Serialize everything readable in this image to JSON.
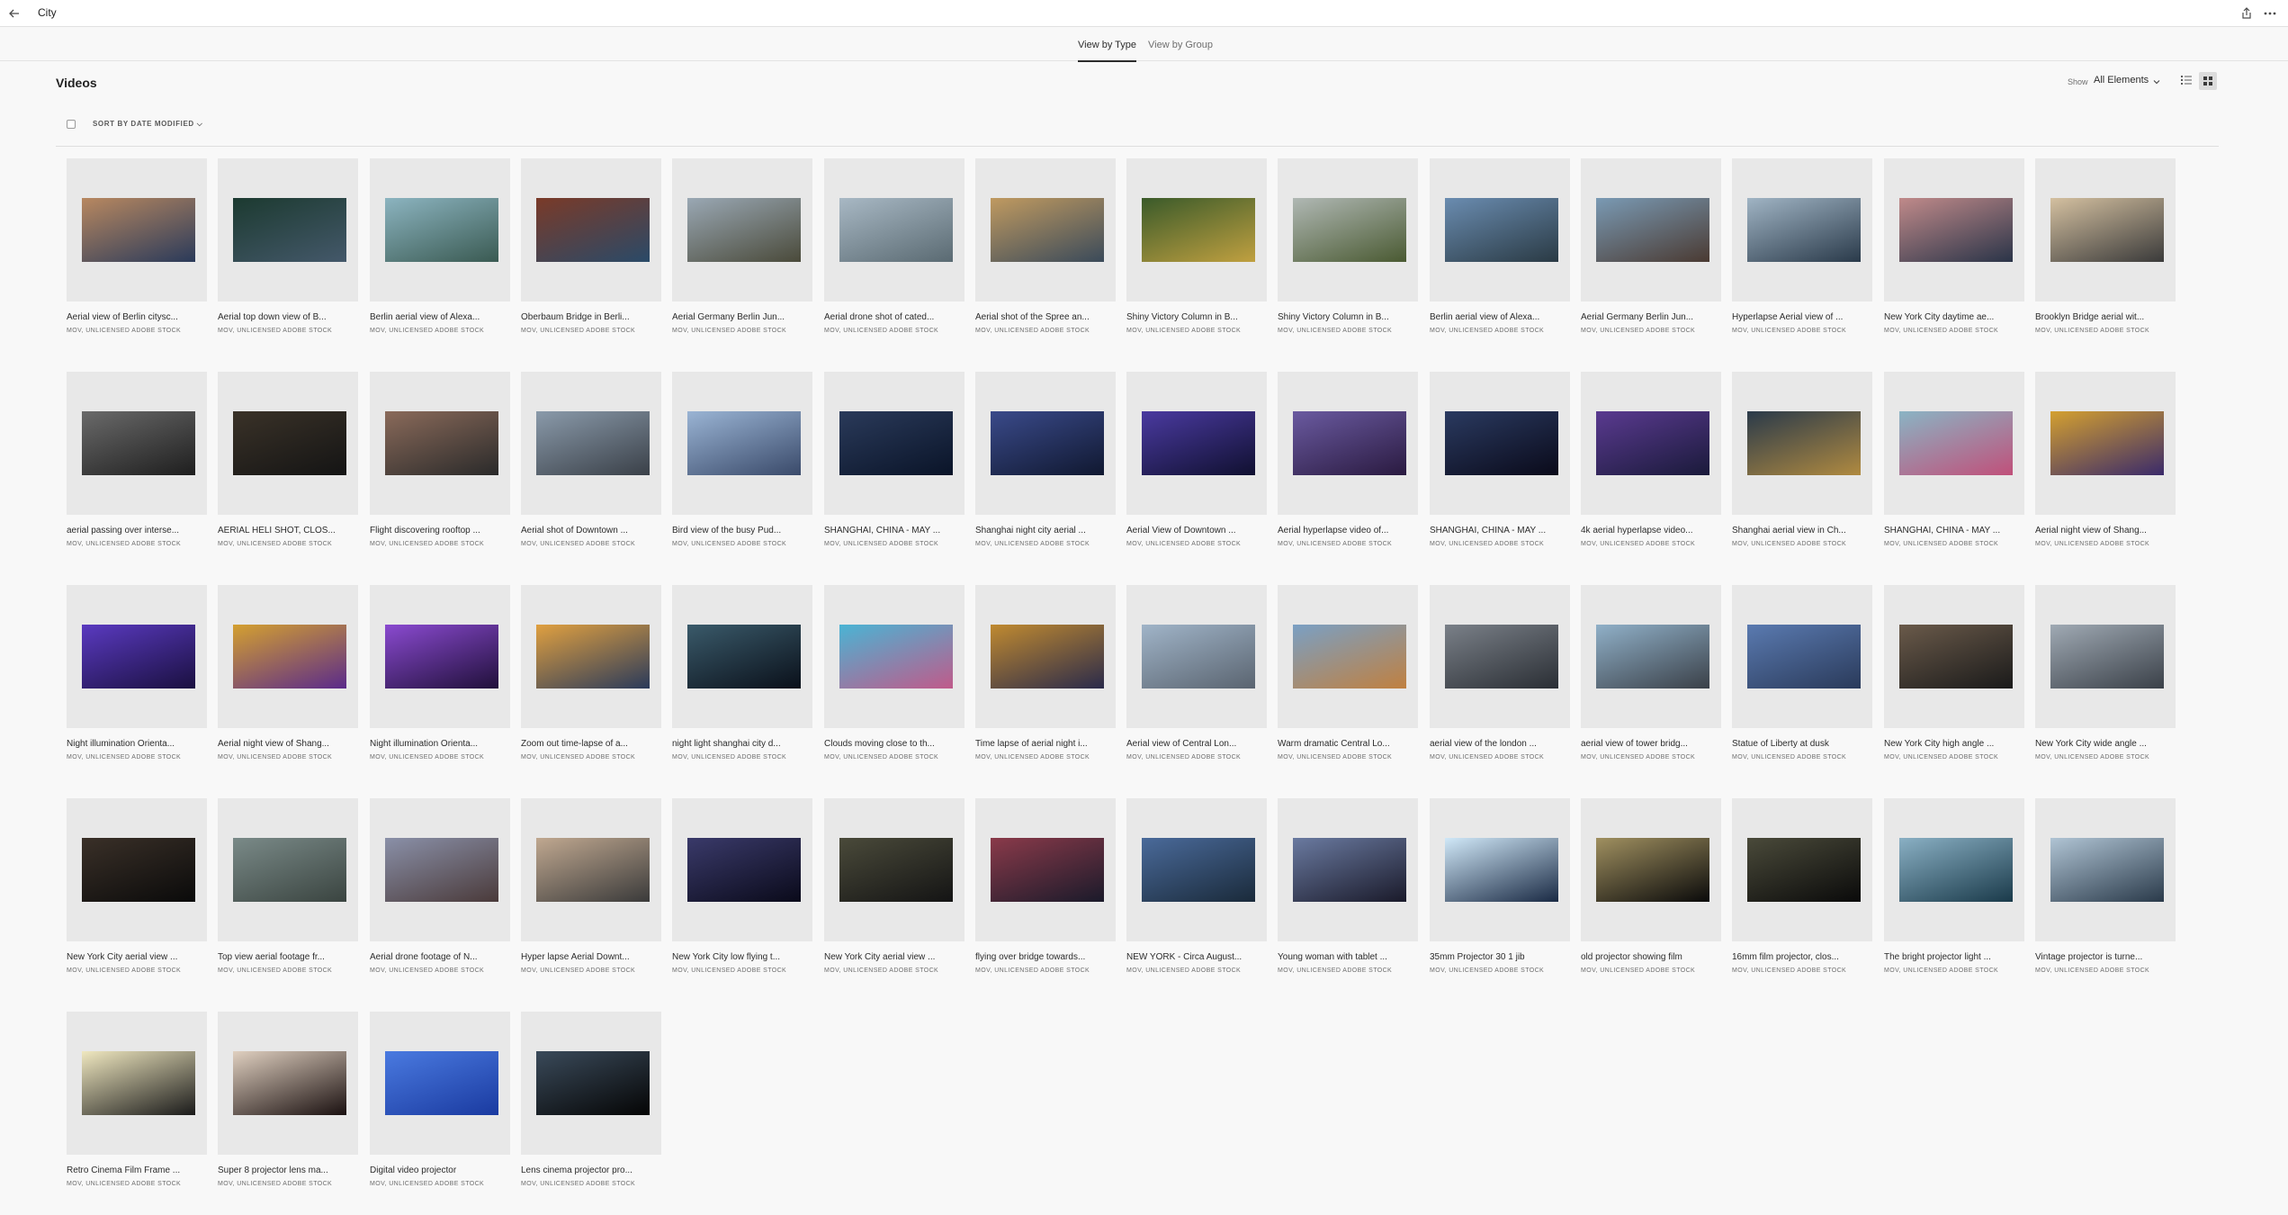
{
  "app": {
    "title": "City"
  },
  "tabs": [
    {
      "label": "View by Type"
    },
    {
      "label": "View by Group"
    }
  ],
  "section": {
    "title": "Videos"
  },
  "filter": {
    "show_label": "Show",
    "show_value": "All Elements"
  },
  "sort": {
    "label": "SORT BY DATE MODIFIED"
  },
  "colors": {
    "thumb_bg": "#e8e8e8",
    "active_tab_underline": "#2c2c2c"
  },
  "icons": {
    "back": "arrow-left-icon",
    "share": "share-icon",
    "more": "more-icon",
    "list": "list-view-icon",
    "grid": "grid-view-icon"
  },
  "items": [
    {
      "name": "Aerial view of Berlin citysc...",
      "meta": "MOV, UNLICENSED ADOBE STOCK",
      "c1": "#b88860",
      "c2": "#2a3a5a"
    },
    {
      "name": "Aerial top down view of B...",
      "meta": "MOV, UNLICENSED ADOBE STOCK",
      "c1": "#1c3a30",
      "c2": "#44586a"
    },
    {
      "name": "Berlin aerial view of Alexa...",
      "meta": "MOV, UNLICENSED ADOBE STOCK",
      "c1": "#8cb4c0",
      "c2": "#3a5a52"
    },
    {
      "name": "Oberbaum Bridge in Berli...",
      "meta": "MOV, UNLICENSED ADOBE STOCK",
      "c1": "#7a3a28",
      "c2": "#2a4a68"
    },
    {
      "name": "Aerial Germany Berlin Jun...",
      "meta": "MOV, UNLICENSED ADOBE STOCK",
      "c1": "#9aa8b4",
      "c2": "#4a4a3a"
    },
    {
      "name": "Aerial drone shot of cated...",
      "meta": "MOV, UNLICENSED ADOBE STOCK",
      "c1": "#a8b8c4",
      "c2": "#5a6a72"
    },
    {
      "name": "Aerial shot of the Spree an...",
      "meta": "MOV, UNLICENSED ADOBE STOCK",
      "c1": "#c09a60",
      "c2": "#3a4a5a"
    },
    {
      "name": "Shiny Victory Column in B...",
      "meta": "MOV, UNLICENSED ADOBE STOCK",
      "c1": "#3a5a2a",
      "c2": "#c0a040"
    },
    {
      "name": "Shiny Victory Column in B...",
      "meta": "MOV, UNLICENSED ADOBE STOCK",
      "c1": "#b0b8b4",
      "c2": "#4a5a32"
    },
    {
      "name": "Berlin aerial view of Alexa...",
      "meta": "MOV, UNLICENSED ADOBE STOCK",
      "c1": "#6a8cb0",
      "c2": "#2a3a44"
    },
    {
      "name": "Aerial Germany Berlin Jun...",
      "meta": "MOV, UNLICENSED ADOBE STOCK",
      "c1": "#7a9ab4",
      "c2": "#4a3a32"
    },
    {
      "name": "Hyperlapse Aerial view of ...",
      "meta": "MOV, UNLICENSED ADOBE STOCK",
      "c1": "#a0b4c4",
      "c2": "#2a3a4a"
    },
    {
      "name": "New York City daytime ae...",
      "meta": "MOV, UNLICENSED ADOBE STOCK",
      "c1": "#c08a8a",
      "c2": "#2a3448"
    },
    {
      "name": "Brooklyn Bridge aerial wit...",
      "meta": "MOV, UNLICENSED ADOBE STOCK",
      "c1": "#d4c0a0",
      "c2": "#3a3a3a"
    },
    {
      "name": "aerial passing over interse...",
      "meta": "MOV, UNLICENSED ADOBE STOCK",
      "c1": "#6a6a6a",
      "c2": "#1e1e1e"
    },
    {
      "name": "AERIAL HELI SHOT, CLOS...",
      "meta": "MOV, UNLICENSED ADOBE STOCK",
      "c1": "#3a3228",
      "c2": "#141414"
    },
    {
      "name": "Flight discovering rooftop ...",
      "meta": "MOV, UNLICENSED ADOBE STOCK",
      "c1": "#8a6a5a",
      "c2": "#2a2a2a"
    },
    {
      "name": "Aerial shot of Downtown ...",
      "meta": "MOV, UNLICENSED ADOBE STOCK",
      "c1": "#8a9aaa",
      "c2": "#3a4048"
    },
    {
      "name": "Bird view of the busy Pud...",
      "meta": "MOV, UNLICENSED ADOBE STOCK",
      "c1": "#9ab4d4",
      "c2": "#3a4a6a"
    },
    {
      "name": "SHANGHAI, CHINA - MAY ...",
      "meta": "MOV, UNLICENSED ADOBE STOCK",
      "c1": "#2a3a5a",
      "c2": "#0a1428"
    },
    {
      "name": "Shanghai night city aerial ...",
      "meta": "MOV, UNLICENSED ADOBE STOCK",
      "c1": "#3a4a8a",
      "c2": "#101830"
    },
    {
      "name": "Aerial View of Downtown ...",
      "meta": "MOV, UNLICENSED ADOBE STOCK",
      "c1": "#4a3aa0",
      "c2": "#101030"
    },
    {
      "name": "Aerial hyperlapse video of...",
      "meta": "MOV, UNLICENSED ADOBE STOCK",
      "c1": "#6a5aa0",
      "c2": "#2a1a40"
    },
    {
      "name": "SHANGHAI, CHINA - MAY ...",
      "meta": "MOV, UNLICENSED ADOBE STOCK",
      "c1": "#2a3a60",
      "c2": "#0a0a1a"
    },
    {
      "name": "4k aerial hyperlapse video...",
      "meta": "MOV, UNLICENSED ADOBE STOCK",
      "c1": "#5a3a90",
      "c2": "#1a1a3a"
    },
    {
      "name": "Shanghai aerial view in Ch...",
      "meta": "MOV, UNLICENSED ADOBE STOCK",
      "c1": "#2a3a4a",
      "c2": "#b08a40"
    },
    {
      "name": "SHANGHAI, CHINA - MAY ...",
      "meta": "MOV, UNLICENSED ADOBE STOCK",
      "c1": "#8ab4c4",
      "c2": "#c0507a"
    },
    {
      "name": "Aerial night view of Shang...",
      "meta": "MOV, UNLICENSED ADOBE STOCK",
      "c1": "#d4a030",
      "c2": "#3a2a6a"
    },
    {
      "name": "Night illumination Orienta...",
      "meta": "MOV, UNLICENSED ADOBE STOCK",
      "c1": "#5a3ac0",
      "c2": "#1a1040"
    },
    {
      "name": "Aerial night view of Shang...",
      "meta": "MOV, UNLICENSED ADOBE STOCK",
      "c1": "#d4a030",
      "c2": "#5a2a8a"
    },
    {
      "name": "Night illumination Orienta...",
      "meta": "MOV, UNLICENSED ADOBE STOCK",
      "c1": "#8a4ad0",
      "c2": "#20103a"
    },
    {
      "name": "Zoom out time-lapse of a...",
      "meta": "MOV, UNLICENSED ADOBE STOCK",
      "c1": "#e0a040",
      "c2": "#2a3a5a"
    },
    {
      "name": "night light shanghai city d...",
      "meta": "MOV, UNLICENSED ADOBE STOCK",
      "c1": "#3a5a6a",
      "c2": "#0a101a"
    },
    {
      "name": "Clouds moving close to th...",
      "meta": "MOV, UNLICENSED ADOBE STOCK",
      "c1": "#4ab4d4",
      "c2": "#c05a8a"
    },
    {
      "name": "Time lapse of aerial night i...",
      "meta": "MOV, UNLICENSED ADOBE STOCK",
      "c1": "#c08a30",
      "c2": "#2a2a4a"
    },
    {
      "name": "Aerial view of Central Lon...",
      "meta": "MOV, UNLICENSED ADOBE STOCK",
      "c1": "#a0b4c8",
      "c2": "#5a6470"
    },
    {
      "name": "Warm dramatic Central Lo...",
      "meta": "MOV, UNLICENSED ADOBE STOCK",
      "c1": "#7aa0c4",
      "c2": "#c08040"
    },
    {
      "name": "aerial view of the london ...",
      "meta": "MOV, UNLICENSED ADOBE STOCK",
      "c1": "#7a8088",
      "c2": "#2a2e34"
    },
    {
      "name": "aerial view of tower bridg...",
      "meta": "MOV, UNLICENSED ADOBE STOCK",
      "c1": "#90b0c8",
      "c2": "#3a4048"
    },
    {
      "name": "Statue of Liberty at dusk",
      "meta": "MOV, UNLICENSED ADOBE STOCK",
      "c1": "#5a7ab0",
      "c2": "#2a3a5a"
    },
    {
      "name": "New York City high angle ...",
      "meta": "MOV, UNLICENSED ADOBE STOCK",
      "c1": "#6a5a4a",
      "c2": "#1a1a1a"
    },
    {
      "name": "New York City wide angle ...",
      "meta": "MOV, UNLICENSED ADOBE STOCK",
      "c1": "#a0aab4",
      "c2": "#3a4048"
    },
    {
      "name": "New York City aerial view ...",
      "meta": "MOV, UNLICENSED ADOBE STOCK",
      "c1": "#3a3028",
      "c2": "#0a0a0a"
    },
    {
      "name": "Top view aerial footage fr...",
      "meta": "MOV, UNLICENSED ADOBE STOCK",
      "c1": "#7a8a88",
      "c2": "#3a4440"
    },
    {
      "name": "Aerial drone footage of N...",
      "meta": "MOV, UNLICENSED ADOBE STOCK",
      "c1": "#8a90a8",
      "c2": "#4a3a3a"
    },
    {
      "name": "Hyper lapse Aerial Downt...",
      "meta": "MOV, UNLICENSED ADOBE STOCK",
      "c1": "#c0a890",
      "c2": "#3a3a3a"
    },
    {
      "name": "New York City low flying t...",
      "meta": "MOV, UNLICENSED ADOBE STOCK",
      "c1": "#3a3a6a",
      "c2": "#0a0a1a"
    },
    {
      "name": "New York City aerial view ...",
      "meta": "MOV, UNLICENSED ADOBE STOCK",
      "c1": "#4a4a3a",
      "c2": "#141414"
    },
    {
      "name": "flying over bridge towards...",
      "meta": "MOV, UNLICENSED ADOBE STOCK",
      "c1": "#8a3a4a",
      "c2": "#1a1a2a"
    },
    {
      "name": "NEW YORK - Circa August...",
      "meta": "MOV, UNLICENSED ADOBE STOCK",
      "c1": "#4a6a9a",
      "c2": "#1a2a3a"
    },
    {
      "name": "Young woman with tablet ...",
      "meta": "MOV, UNLICENSED ADOBE STOCK",
      "c1": "#6a7aa0",
      "c2": "#1a1a2a"
    },
    {
      "name": "35mm Projector 30 1 jib",
      "meta": "MOV, UNLICENSED ADOBE STOCK",
      "c1": "#d0e8f8",
      "c2": "#1a2a44"
    },
    {
      "name": "old projector showing film",
      "meta": "MOV, UNLICENSED ADOBE STOCK",
      "c1": "#a09060",
      "c2": "#0a0a0a"
    },
    {
      "name": "16mm film projector, clos...",
      "meta": "MOV, UNLICENSED ADOBE STOCK",
      "c1": "#4a4a3a",
      "c2": "#0a0a0a"
    },
    {
      "name": "The bright projector light ...",
      "meta": "MOV, UNLICENSED ADOBE STOCK",
      "c1": "#8ab0c4",
      "c2": "#1a3a4a"
    },
    {
      "name": "Vintage projector is turne...",
      "meta": "MOV, UNLICENSED ADOBE STOCK",
      "c1": "#b0c4d4",
      "c2": "#2a3a4a"
    },
    {
      "name": "Retro Cinema Film Frame ...",
      "meta": "MOV, UNLICENSED ADOBE STOCK",
      "c1": "#f0e8c0",
      "c2": "#1a1a1a"
    },
    {
      "name": "Super 8 projector lens ma...",
      "meta": "MOV, UNLICENSED ADOBE STOCK",
      "c1": "#e0d0c0",
      "c2": "#1a1010"
    },
    {
      "name": "Digital video projector",
      "meta": "MOV, UNLICENSED ADOBE STOCK",
      "c1": "#4a7ae0",
      "c2": "#1a3aa0"
    },
    {
      "name": "Lens cinema projector pro...",
      "meta": "MOV, UNLICENSED ADOBE STOCK",
      "c1": "#3a4a5a",
      "c2": "#050505"
    }
  ]
}
